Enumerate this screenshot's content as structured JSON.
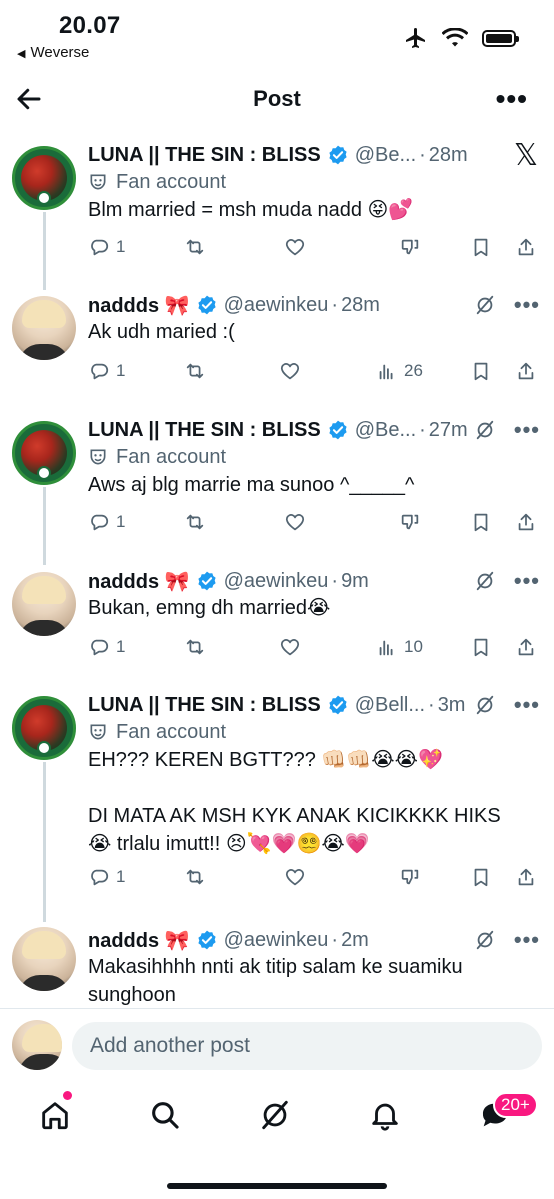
{
  "status_bar": {
    "time": "20.07",
    "back_app": "Weverse"
  },
  "header": {
    "title": "Post"
  },
  "posts": [
    {
      "name": "LUNA || THE SIN : BLISS",
      "handle": "@Be...",
      "time": "28m",
      "fan_label": "Fan account",
      "text": "Blm married = msh muda nadd 😝💕",
      "replies": "1",
      "views": "",
      "avatar": "luna",
      "top_right": "x-logo"
    },
    {
      "name": "naddds 🎀",
      "handle": "@aewinkeu",
      "time": "28m",
      "text": "Ak udh maried :(",
      "replies": "1",
      "views": "26",
      "avatar": "nad",
      "top_right": "grok"
    },
    {
      "name": "LUNA || THE SIN : BLISS",
      "handle": "@Be...",
      "time": "27m",
      "fan_label": "Fan account",
      "text": "Aws aj blg marrie ma sunoo ^_____^",
      "replies": "1",
      "views": "",
      "avatar": "luna",
      "top_right": "grok"
    },
    {
      "name": "naddds 🎀",
      "handle": "@aewinkeu",
      "time": "9m",
      "text": "Bukan, emng dh married😭",
      "replies": "1",
      "views": "10",
      "avatar": "nad",
      "top_right": "grok"
    },
    {
      "name": "LUNA || THE SIN : BLISS",
      "handle": "@Bell...",
      "time": "3m",
      "fan_label": "Fan account",
      "text": "EH??? KEREN BGTT??? 👊🏻👊🏻😭😭💖\n\nDI MATA AK MSH KYK ANAK KICIKKKK HIKS\n😭 trlalu imutt!! 😣💘💗😵‍💫😭💗",
      "replies": "1",
      "views": "",
      "avatar": "luna",
      "top_right": "grok"
    },
    {
      "name": "naddds 🎀",
      "handle": "@aewinkeu",
      "time": "2m",
      "text": "Makasihhhh nnti ak titip salam ke suamiku\nsunghoon",
      "replies": "",
      "views": "",
      "avatar": "nad",
      "top_right": "grok"
    }
  ],
  "composer": {
    "placeholder": "Add another post"
  },
  "tabbar": {
    "messages_badge": "20+"
  },
  "colors": {
    "accent_pink": "#f91880",
    "verified_blue": "#1d9bf0",
    "muted": "#536471"
  }
}
